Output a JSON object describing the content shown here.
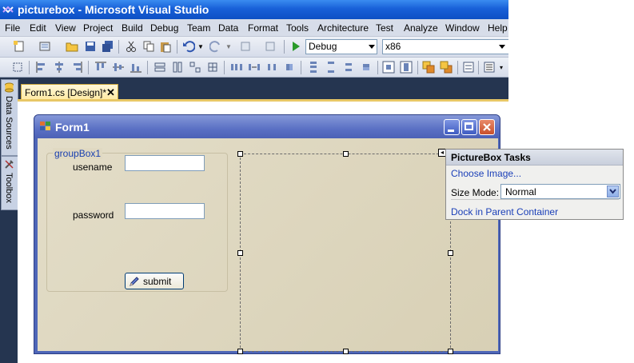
{
  "window": {
    "title": "picturebox - Microsoft Visual Studio"
  },
  "menu": [
    "File",
    "Edit",
    "View",
    "Project",
    "Build",
    "Debug",
    "Team",
    "Data",
    "Format",
    "Tools",
    "Architecture",
    "Test",
    "Analyze",
    "Window",
    "Help"
  ],
  "toolbar": {
    "configuration": "Debug",
    "platform": "x86"
  },
  "side_tabs": [
    "Data Sources",
    "Toolbox"
  ],
  "doc_tab": {
    "label": "Form1.cs [Design]*",
    "close": "✕"
  },
  "form": {
    "title": "Form1",
    "group_caption": "groupBox1",
    "username_label": "usename",
    "password_label": "password",
    "submit_label": "submit"
  },
  "tasks_panel": {
    "title": "PictureBox Tasks",
    "choose_image": "Choose Image...",
    "size_mode_label": "Size Mode:",
    "size_mode_value": "Normal",
    "dock_link": "Dock in Parent Container"
  },
  "colors": {
    "title_bar": "#1860d8",
    "form_title": "#5a70c4",
    "close_button": "#c8502c",
    "link": "#1a3fb8",
    "design_area_dark": "#253550"
  }
}
